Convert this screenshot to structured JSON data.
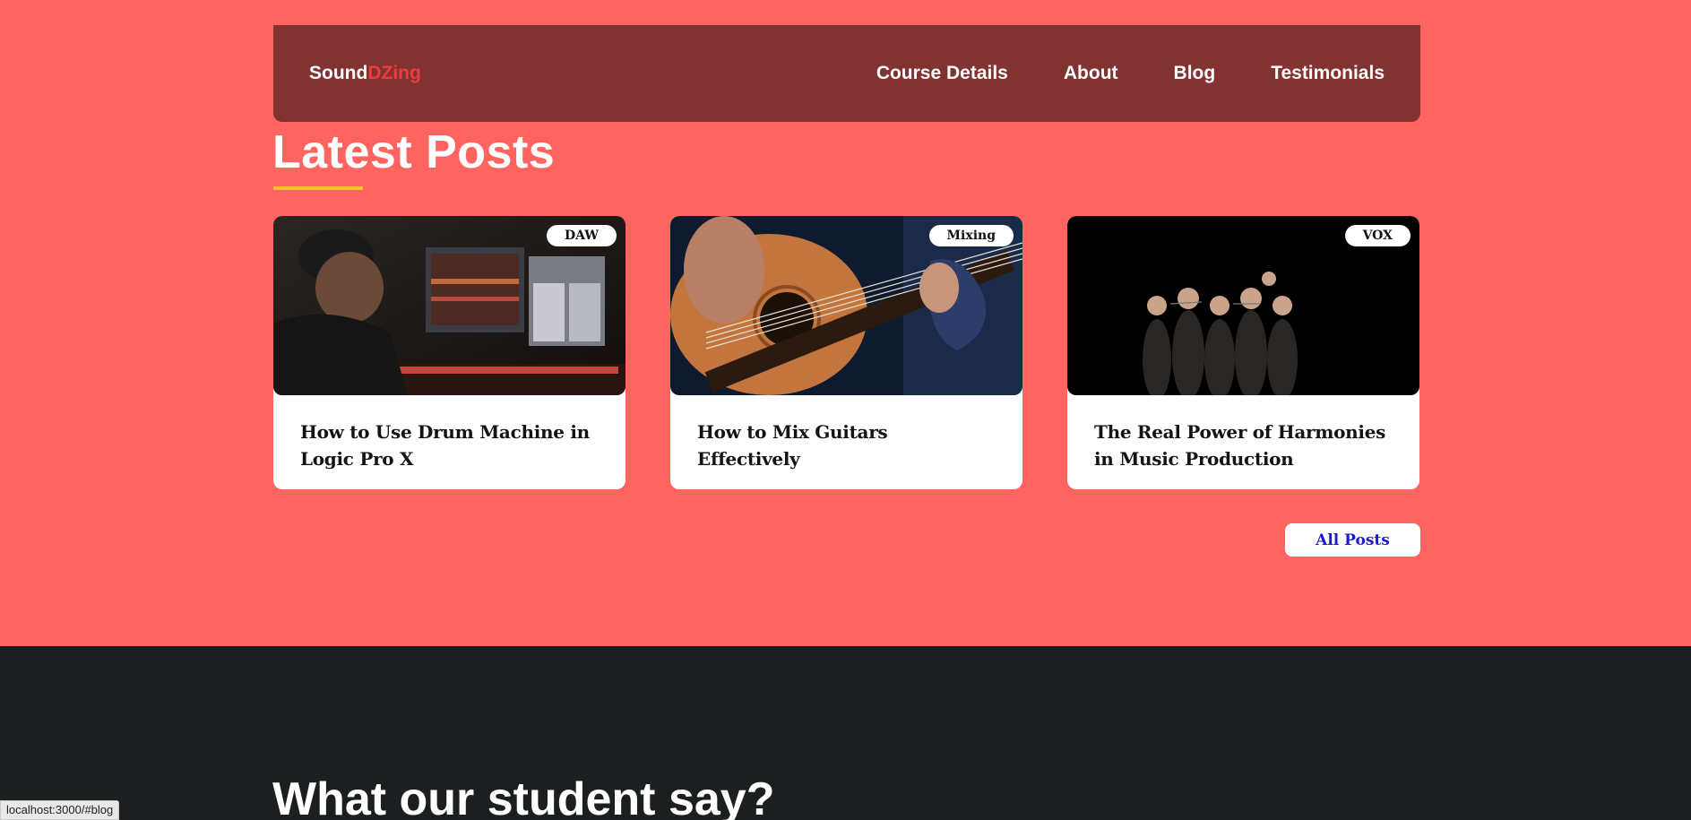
{
  "navbar": {
    "logo_main": "Sound",
    "logo_accent": "DZing",
    "links": [
      "Course Details",
      "About",
      "Blog",
      "Testimonials"
    ]
  },
  "blog": {
    "title": "Latest Posts",
    "posts": [
      {
        "badge": "DAW",
        "title": "How to Use Drum Machine in Logic Pro X",
        "image": "music-studio-daw-photo"
      },
      {
        "badge": "Mixing",
        "title": "How to Mix Guitars Effectively",
        "image": "acoustic-guitar-photo"
      },
      {
        "badge": "VOX",
        "title": "The Real Power of Harmonies in Music Production",
        "image": "choir-on-stage-photo"
      }
    ],
    "all_posts_label": "All Posts"
  },
  "testimonials": {
    "title": "What our student say?"
  },
  "status_bar": {
    "url": "localhost:3000/#blog"
  },
  "colors": {
    "page_bg": "#ff6461",
    "navbar_bg": "#813331",
    "logo_accent": "#f23a3e",
    "underline": "#f5c12e",
    "dark_section": "#1b1f1f",
    "link_blue": "#1a1ad6"
  }
}
